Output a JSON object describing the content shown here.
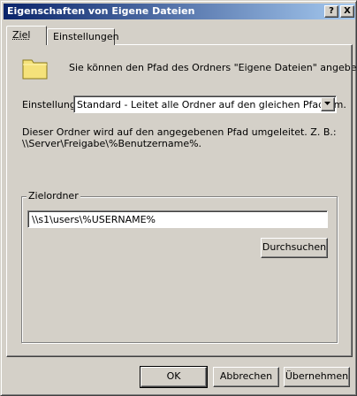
{
  "window": {
    "title": "Eigenschaften von Eigene Dateien",
    "help_label": "?",
    "close_label": "X"
  },
  "tabs": [
    {
      "label": "Ziel",
      "selected": true
    },
    {
      "label": "Einstellungen",
      "selected": false
    }
  ],
  "ziel": {
    "intro": "Sie können den Pfad des Ordners \"Eigene Dateien\" angeben.",
    "einstellung_label": "Einstellung:",
    "einstellung_value": "Standard - Leitet alle Ordner auf den gleichen Pfad um.",
    "description_line1": "Dieser Ordner wird auf den angegebenen Pfad umgeleitet. Z. B.:",
    "description_line2": "\\\\Server\\Freigabe\\%Benutzername%.",
    "group_label": "Zielordner",
    "path_value": "\\\\s1\\users\\%USERNAME%",
    "browse_label": "Durchsuchen"
  },
  "footer": {
    "ok_label": "OK",
    "cancel_label": "Abbrechen",
    "apply_label": "Übernehmen"
  },
  "icons": {
    "folder": "folder-icon",
    "dropdown": "chevron-down-icon"
  },
  "colors": {
    "titlebar_start": "#0a246a",
    "titlebar_end": "#a6caf0",
    "face": "#d4d0c8",
    "folder": "#f5e27a"
  }
}
